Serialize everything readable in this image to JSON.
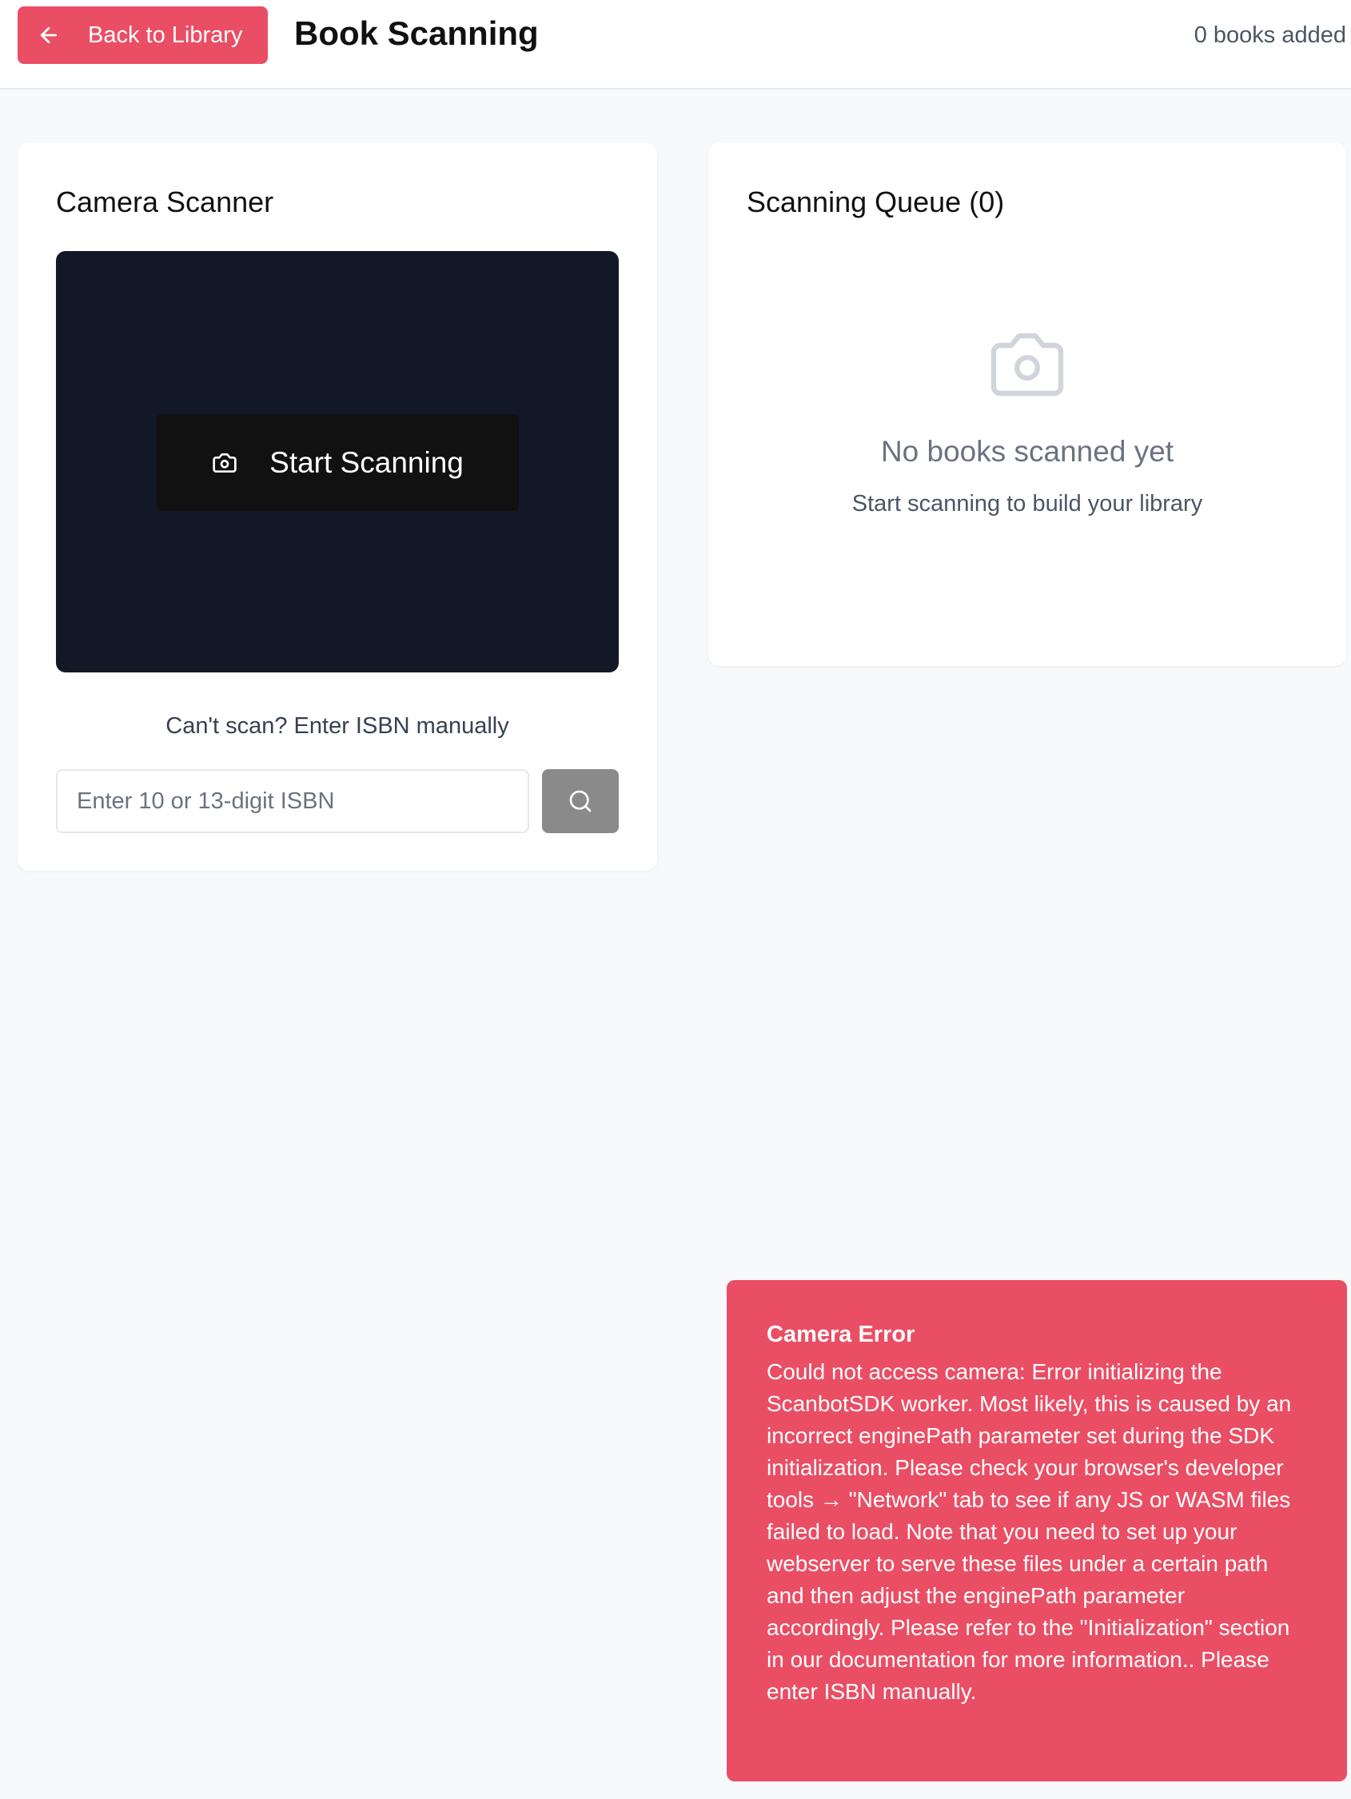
{
  "header": {
    "back_label": "Back to Library",
    "title": "Book Scanning",
    "books_added": "0 books added"
  },
  "scanner": {
    "title": "Camera Scanner",
    "start_label": "Start Scanning",
    "manual_hint": "Can't scan? Enter ISBN manually",
    "isbn_placeholder": "Enter 10 or 13-digit ISBN",
    "isbn_value": ""
  },
  "queue": {
    "title": "Scanning Queue (0)",
    "empty_title": "No books scanned yet",
    "empty_subtitle": "Start scanning to build your library"
  },
  "toast": {
    "title": "Camera Error",
    "message": "Could not access camera: Error initializing the ScanbotSDK worker. Most likely, this is caused by an incorrect enginePath parameter set during the SDK initialization. Please check your browser's developer tools → \"Network\" tab to see if any JS or WASM files failed to load. Note that you need to set up your webserver to serve these files under a certain path and then adjust the enginePath parameter accordingly. Please refer to the \"Initialization\" section in our documentation for more information.. Please enter ISBN manually."
  },
  "icons": {
    "back": "arrow-left-icon",
    "camera": "camera-icon",
    "search": "search-icon",
    "empty": "camera-icon"
  },
  "colors": {
    "accent": "#ea4e64",
    "camera_bg": "#131826",
    "start_button": "#111111",
    "search_button": "#8a8a8a",
    "page_bg": "#f8f9fb"
  }
}
